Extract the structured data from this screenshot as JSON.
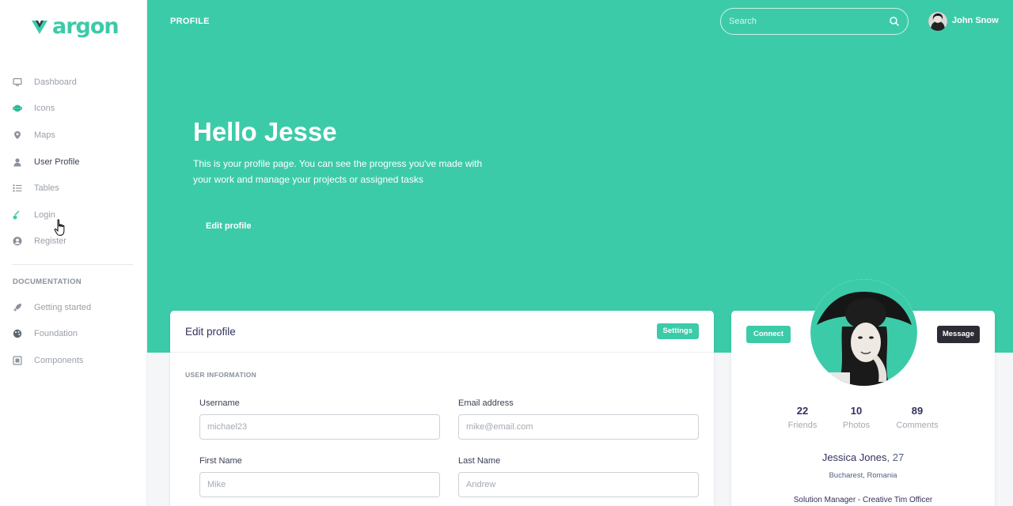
{
  "brand": {
    "name": "argon",
    "color": "#3ccba8"
  },
  "sidebar": {
    "items": [
      {
        "label": "Dashboard",
        "icon": "monitor-icon",
        "active": false
      },
      {
        "label": "Icons",
        "icon": "planet-icon",
        "active": false
      },
      {
        "label": "Maps",
        "icon": "pin-icon",
        "active": false
      },
      {
        "label": "User Profile",
        "icon": "user-icon",
        "active": true
      },
      {
        "label": "Tables",
        "icon": "list-icon",
        "active": false
      },
      {
        "label": "Login",
        "icon": "key-icon",
        "active": false
      },
      {
        "label": "Register",
        "icon": "circle-user-icon",
        "active": false
      }
    ],
    "doc_heading": "DOCUMENTATION",
    "doc_items": [
      {
        "label": "Getting started",
        "icon": "rocket-icon"
      },
      {
        "label": "Foundation",
        "icon": "palette-icon"
      },
      {
        "label": "Components",
        "icon": "components-icon"
      }
    ]
  },
  "header": {
    "title": "PROFILE",
    "search_placeholder": "Search",
    "user_name": "John Snow"
  },
  "hero": {
    "greeting": "Hello Jesse",
    "text": "This is your profile page. You can see the progress you've made with your work and manage your projects or assigned tasks",
    "edit_label": "Edit profile"
  },
  "edit_card": {
    "title": "Edit profile",
    "settings_label": "Settings",
    "section_heading": "USER INFORMATION",
    "fields": {
      "username": {
        "label": "Username",
        "placeholder": "michael23"
      },
      "email": {
        "label": "Email address",
        "placeholder": "mike@email.com"
      },
      "first_name": {
        "label": "First Name",
        "placeholder": "Mike"
      },
      "last_name": {
        "label": "Last Name",
        "placeholder": "Andrew"
      }
    }
  },
  "profile_card": {
    "connect_label": "Connect",
    "message_label": "Message",
    "stats": [
      {
        "value": "22",
        "label": "Friends"
      },
      {
        "value": "10",
        "label": "Photos"
      },
      {
        "value": "89",
        "label": "Comments"
      }
    ],
    "name": "Jessica Jones",
    "age": ", 27",
    "location": "Bucharest, Romania",
    "job": "Solution Manager - Creative Tim Officer"
  }
}
